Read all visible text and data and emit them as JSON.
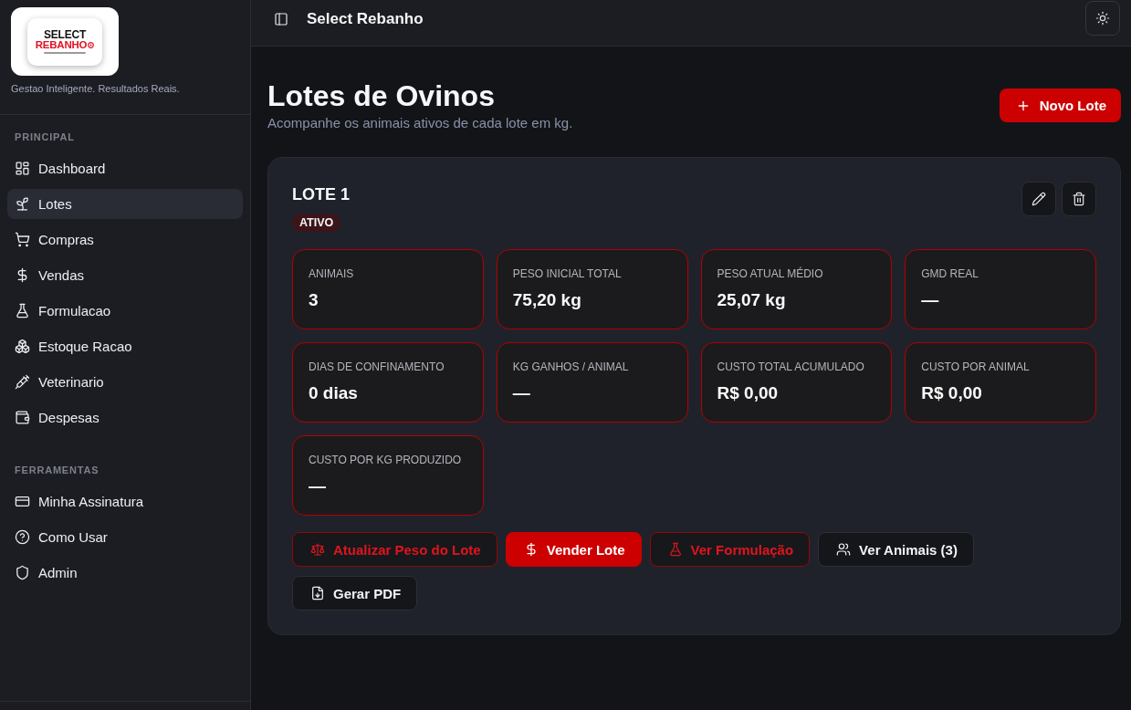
{
  "sidebar": {
    "logo": {
      "line_1": "SELECT",
      "line_2": "REBANHO"
    },
    "tagline": "Gestao Inteligente. Resultados Reais.",
    "sections": [
      {
        "title": "PRINCIPAL",
        "items": [
          {
            "label": "Dashboard",
            "selected": false
          },
          {
            "label": "Lotes",
            "selected": true
          },
          {
            "label": "Compras",
            "selected": false
          },
          {
            "label": "Vendas",
            "selected": false
          },
          {
            "label": "Formulacao",
            "selected": false
          },
          {
            "label": "Estoque Racao",
            "selected": false
          },
          {
            "label": "Veterinario",
            "selected": false
          },
          {
            "label": "Despesas",
            "selected": false
          }
        ]
      },
      {
        "title": "FERRAMENTAS",
        "items": [
          {
            "label": "Minha Assinatura",
            "selected": false
          },
          {
            "label": "Como Usar",
            "selected": false
          },
          {
            "label": "Admin",
            "selected": false
          }
        ]
      }
    ]
  },
  "header": {
    "title": "Select Rebanho"
  },
  "page": {
    "title": "Lotes de Ovinos",
    "subtitle": "Acompanhe os animais ativos de cada lote em kg.",
    "new_button": "Novo Lote"
  },
  "lot": {
    "name": "LOTE 1",
    "status": "ATIVO",
    "stats": [
      {
        "label": "ANIMAIS",
        "value": "3"
      },
      {
        "label": "PESO INICIAL TOTAL",
        "value": "75,20 kg"
      },
      {
        "label": "PESO ATUAL MÉDIO",
        "value": "25,07 kg"
      },
      {
        "label": "GMD REAL",
        "value": "—"
      },
      {
        "label": "DIAS DE CONFINAMENTO",
        "value": "0 dias"
      },
      {
        "label": "KG GANHOS / ANIMAL",
        "value": "—"
      },
      {
        "label": "CUSTO TOTAL ACUMULADO",
        "value": "R$ 0,00"
      },
      {
        "label": "CUSTO POR ANIMAL",
        "value": "R$ 0,00"
      },
      {
        "label": "CUSTO POR KG PRODUZIDO",
        "value": "—"
      }
    ],
    "actions": [
      {
        "label": "Atualizar Peso do Lote",
        "kind": "outline"
      },
      {
        "label": "Vender Lote",
        "kind": "primary"
      },
      {
        "label": "Ver Formulação",
        "kind": "outline"
      },
      {
        "label": "Ver Animais (3)",
        "kind": "secondary"
      },
      {
        "label": "Gerar PDF",
        "kind": "secondary"
      }
    ]
  }
}
